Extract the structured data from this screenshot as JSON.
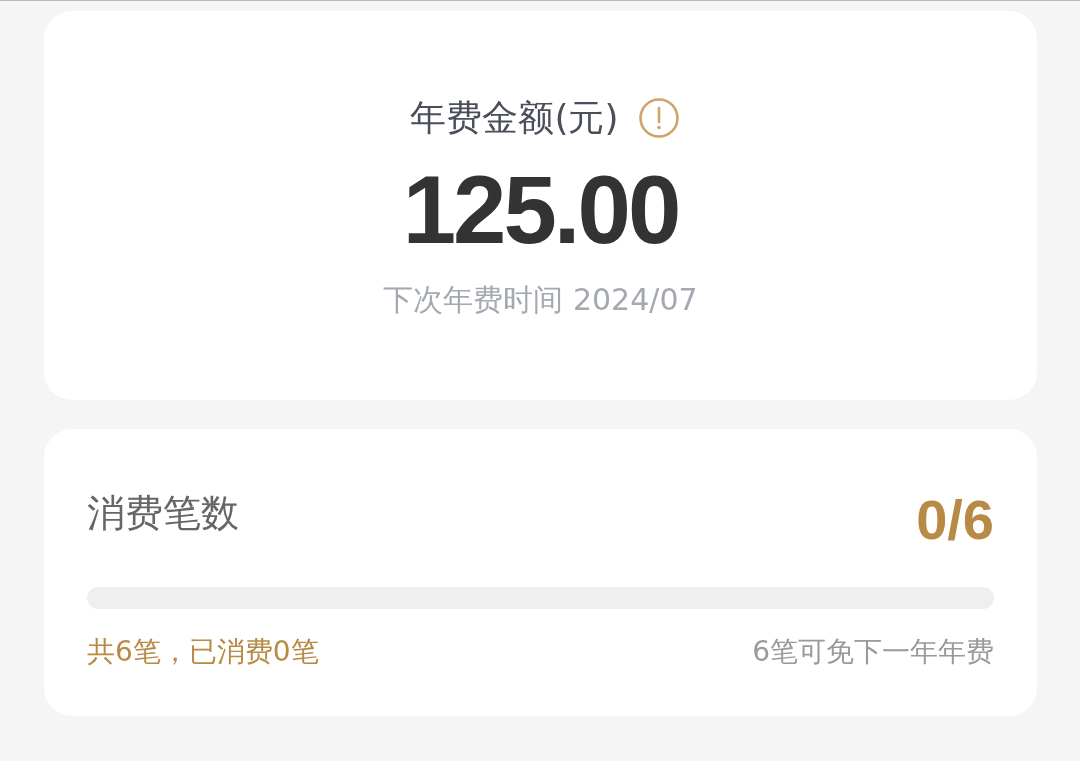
{
  "fee_card": {
    "title": "年费金额(元)",
    "amount": "125.00",
    "next_fee_date": "下次年费时间 2024/07"
  },
  "consumption_card": {
    "title": "消费笔数",
    "count": "0/6",
    "progress_note": "共6笔，已消费0笔",
    "waiver_note": "6笔可免下一年年费"
  }
}
